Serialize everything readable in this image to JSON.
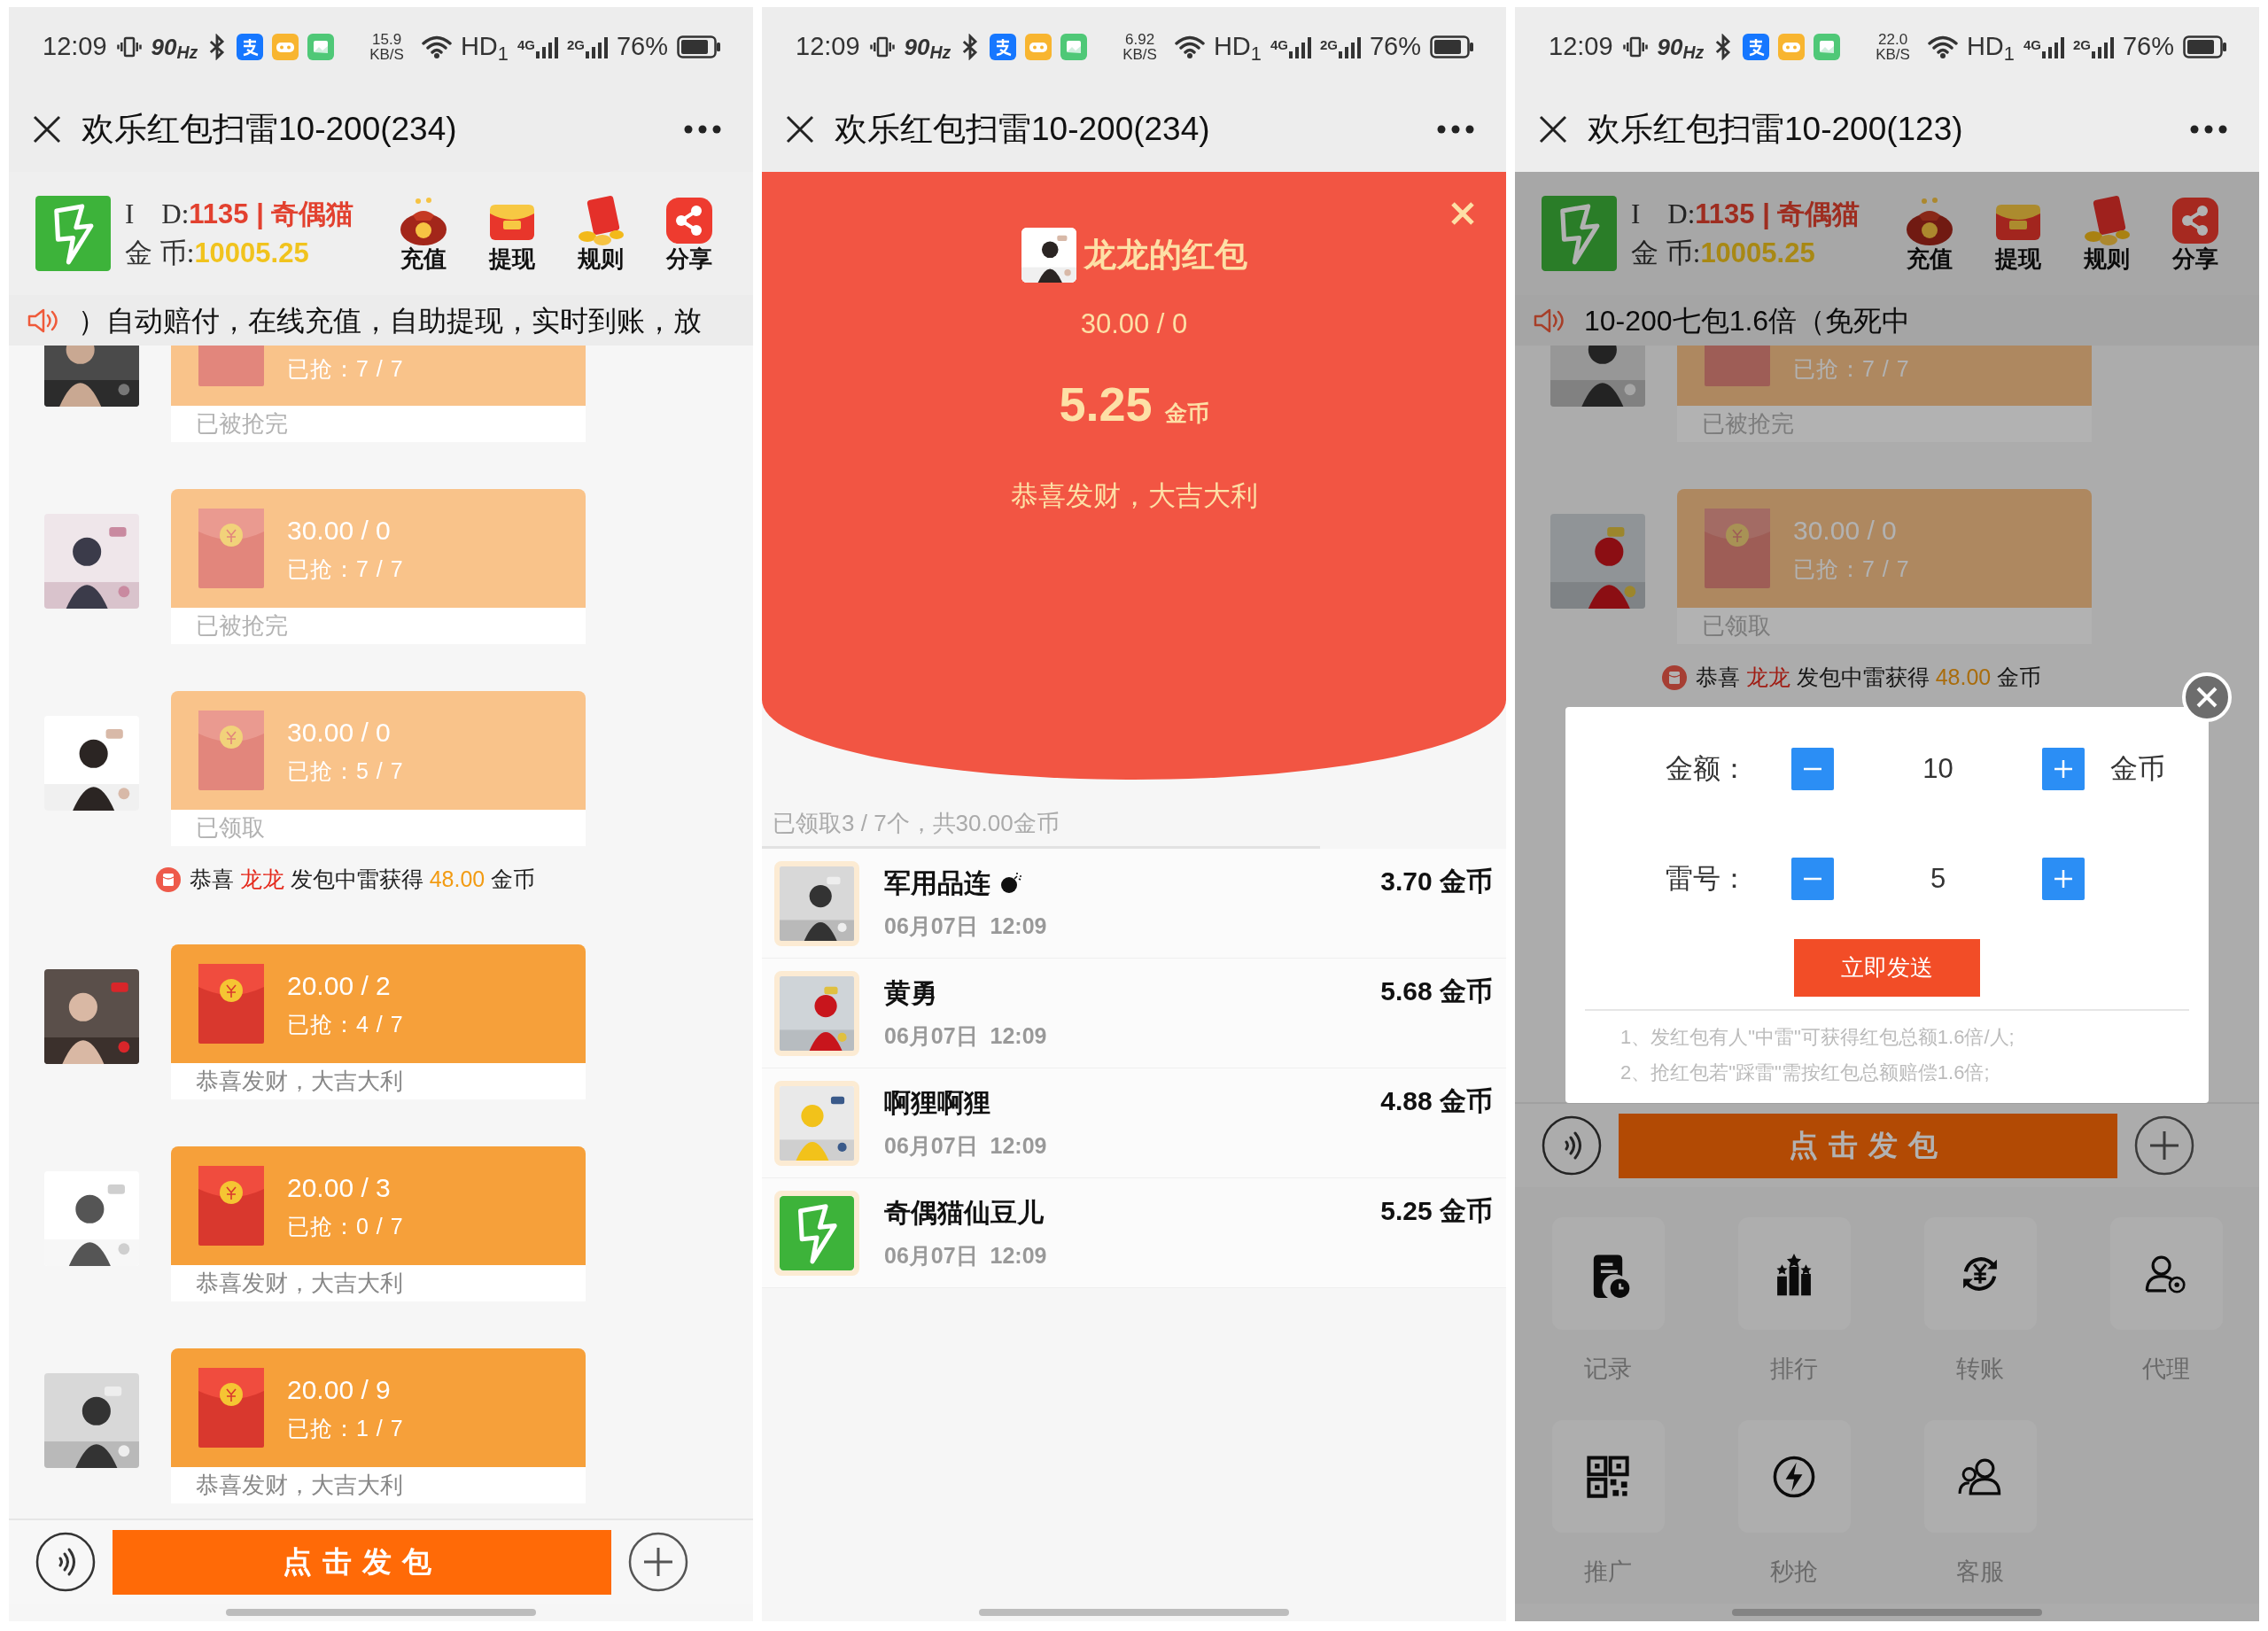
{
  "screens": [
    {
      "kind": "chat",
      "status_bar": {
        "time": "12:09",
        "refresh_rate": "90$_{Hz}$",
        "speed": "15.9",
        "speed_unit": "KB/S",
        "network": "HD$_{1}$",
        "signal_1": "4G",
        "signal_2": "2G",
        "battery": "76%"
      },
      "title": "欢乐红包扫雷10-200(234)",
      "account": {
        "id_label": "I　D:",
        "id_value": "1135 | 奇偶猫",
        "coin_label": "金 币:",
        "coin_value": "10005.25"
      },
      "actions": [
        {
          "label": "充值"
        },
        {
          "label": "提现"
        },
        {
          "label": "规则"
        },
        {
          "label": "分享"
        }
      ],
      "marquee": "）自动赔付，在线充值，自助提现，实时到账，放",
      "feed": [
        {
          "kind": "packet",
          "grabbed": "已抢：7 / 7",
          "footer": "已被抢完",
          "opened": true
        },
        {
          "kind": "packet",
          "amount": "30.00 / 0",
          "grabbed": "已抢：7 / 7",
          "footer": "已被抢完",
          "opened": true
        },
        {
          "kind": "packet",
          "amount": "30.00 / 0",
          "grabbed": "已抢：5 / 7",
          "footer": "已领取",
          "opened": true
        },
        {
          "kind": "notice",
          "prefix": "恭喜",
          "name": "龙龙",
          "middle": "发包中雷获得",
          "amount": "48.00",
          "suffix": "金币"
        },
        {
          "kind": "packet",
          "amount": "20.00 / 2",
          "grabbed": "已抢：4 / 7",
          "footer": "恭喜发财，大吉大利",
          "opened": false
        },
        {
          "kind": "packet",
          "amount": "20.00 / 3",
          "grabbed": "已抢：0 / 7",
          "footer": "恭喜发财，大吉大利",
          "opened": false
        },
        {
          "kind": "packet",
          "amount": "20.00 / 9",
          "grabbed": "已抢：1 / 7",
          "footer": "恭喜发财，大吉大利",
          "opened": false
        }
      ],
      "send_button": "点击发包"
    },
    {
      "kind": "envelope",
      "status_bar": {
        "time": "12:09",
        "refresh_rate": "90$_{Hz}$",
        "speed": "6.92",
        "speed_unit": "KB/S",
        "network": "HD$_{1}$",
        "signal_1": "4G",
        "signal_2": "2G",
        "battery": "76%"
      },
      "title": "欢乐红包扫雷10-200(234)",
      "packet": {
        "sender": "龙龙的红包",
        "amount": "30.00 / 0",
        "received": "5.25",
        "unit": "金币",
        "greeting": "恭喜发财，大吉大利"
      },
      "summary": "已领取3 / 7个，共30.00金币",
      "claims": [
        {
          "kind": "picture",
          "name": "军用品连",
          "hit_mine": true,
          "time": "06月07日  12:09",
          "amount": "3.70 金币"
        },
        {
          "kind": "picture",
          "name": "黄勇",
          "hit_mine": false,
          "time": "06月07日  12:09",
          "amount": "5.68 金币"
        },
        {
          "kind": "picture",
          "name": "啊狸啊狸",
          "hit_mine": false,
          "time": "06月07日  12:09",
          "amount": "4.88 金币"
        },
        {
          "kind": "logo",
          "name": "奇偶猫仙豆儿",
          "hit_mine": false,
          "time": "06月07日  12:09",
          "amount": "5.25 金币"
        }
      ]
    },
    {
      "kind": "chat",
      "status_bar": {
        "time": "12:09",
        "refresh_rate": "90$_{Hz}$",
        "speed": "22.0",
        "speed_unit": "KB/S",
        "network": "HD$_{1}$",
        "signal_1": "4G",
        "signal_2": "2G",
        "battery": "76%"
      },
      "title": "欢乐红包扫雷10-200(123)",
      "account": {
        "id_label": "I　D:",
        "id_value": "1135 | 奇偶猫",
        "coin_label": "金 币:",
        "coin_value": "10005.25"
      },
      "actions": [
        {
          "label": "充值"
        },
        {
          "label": "提现"
        },
        {
          "label": "规则"
        },
        {
          "label": "分享"
        }
      ],
      "marquee": "10-200七包1.6倍（免死中",
      "feed": [
        {
          "kind": "packet",
          "grabbed": "已抢：7 / 7",
          "footer": "已被抢完",
          "opened": true
        },
        {
          "kind": "packet",
          "amount": "30.00 / 0",
          "grabbed": "已抢：7 / 7",
          "footer": "已领取",
          "opened": true
        },
        {
          "kind": "notice",
          "prefix": "恭喜",
          "name": "龙龙",
          "middle": "发包中雷获得",
          "amount": "48.00",
          "suffix": "金币"
        }
      ],
      "send_button": "点击发包",
      "dialog": {
        "rows": [
          {
            "label": "金额：",
            "value": "10",
            "unit": "金币"
          },
          {
            "label": "雷号：",
            "value": "5"
          }
        ],
        "submit": "立即发送",
        "rules": [
          "1、发红包有人\"中雷\"可获得红包总额1.6倍/人;",
          "2、抢红包若\"踩雷\"需按红包总额赔偿1.6倍;"
        ]
      },
      "menu": [
        {
          "label": "记录"
        },
        {
          "label": "排行"
        },
        {
          "label": "转账"
        },
        {
          "label": "代理"
        },
        {
          "label": "推广"
        },
        {
          "label": "秒抢"
        },
        {
          "label": "客服"
        }
      ]
    }
  ]
}
